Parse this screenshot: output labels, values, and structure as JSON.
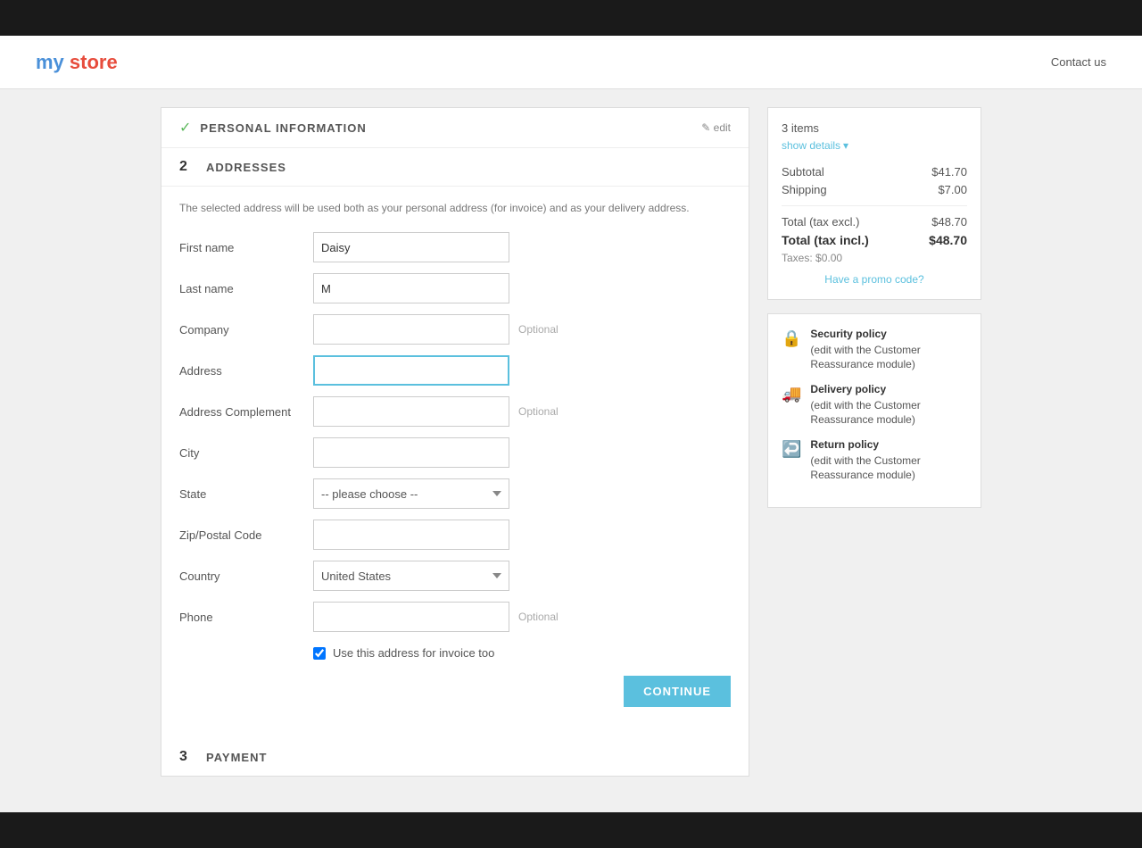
{
  "topBar": {},
  "nav": {
    "logo": {
      "my": "my",
      "store": "store"
    },
    "contactUs": "Contact us"
  },
  "steps": {
    "step1": {
      "number": "",
      "checkmark": "✓",
      "title": "PERSONAL INFORMATION",
      "editLabel": "✎ edit"
    },
    "step2": {
      "number": "2",
      "title": "ADDRESSES",
      "description": "The selected address will be used both as your personal address (for invoice) and as your delivery address."
    },
    "step3": {
      "number": "3",
      "title": "PAYMENT"
    }
  },
  "form": {
    "firstNameLabel": "First name",
    "firstNameValue": "Daisy",
    "lastNameLabel": "Last name",
    "lastNameValue": "M",
    "companyLabel": "Company",
    "companyValue": "",
    "companyOptional": "Optional",
    "addressLabel": "Address",
    "addressValue": "",
    "addressComplementLabel": "Address Complement",
    "addressComplementValue": "",
    "addressComplementOptional": "Optional",
    "cityLabel": "City",
    "cityValue": "",
    "stateLabel": "State",
    "statePlaceholder": "-- please choose --",
    "zipLabel": "Zip/Postal Code",
    "zipValue": "",
    "countryLabel": "Country",
    "countryValue": "United States",
    "phoneLabel": "Phone",
    "phoneValue": "",
    "phoneOptional": "Optional",
    "checkboxLabel": "Use this address for invoice too",
    "checkboxChecked": true,
    "continueButton": "CONTINUE"
  },
  "sidebar": {
    "itemsCount": "3 items",
    "showDetails": "show details",
    "subtotalLabel": "Subtotal",
    "subtotalValue": "$41.70",
    "shippingLabel": "Shipping",
    "shippingValue": "$7.00",
    "totalExclLabel": "Total (tax excl.)",
    "totalExclValue": "$48.70",
    "totalInclLabel": "Total (tax incl.)",
    "totalInclValue": "$48.70",
    "taxesLabel": "Taxes: $0.00",
    "promoLink": "Have a promo code?",
    "policies": [
      {
        "name": "Security policy",
        "description": "(edit with the Customer Reassurance module)"
      },
      {
        "name": "Delivery policy",
        "description": "(edit with the Customer Reassurance module)"
      },
      {
        "name": "Return policy",
        "description": "(edit with the Customer Reassurance module)"
      }
    ]
  }
}
